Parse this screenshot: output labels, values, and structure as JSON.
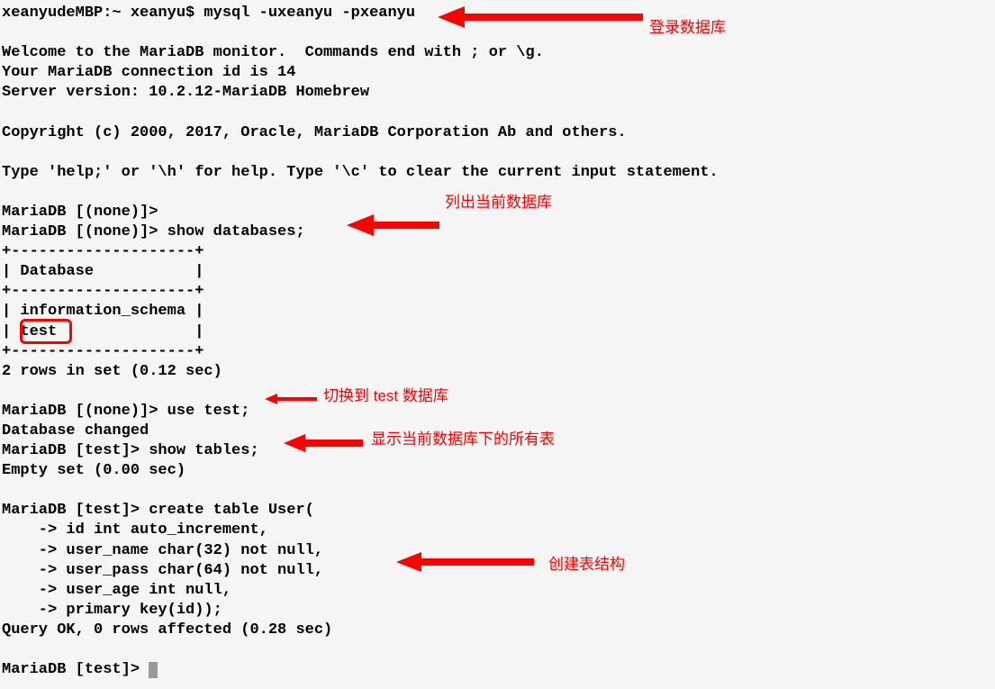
{
  "term": {
    "l0": "xeanyudeMBP:~ xeanyu$ mysql -uxeanyu -pxeanyu",
    "blank": "",
    "l1": "Welcome to the MariaDB monitor.  Commands end with ; or \\g.",
    "l2": "Your MariaDB connection id is 14",
    "l3": "Server version: 10.2.12-MariaDB Homebrew",
    "l4": "Copyright (c) 2000, 2017, Oracle, MariaDB Corporation Ab and others.",
    "l5": "Type 'help;' or '\\h' for help. Type '\\c' to clear the current input statement.",
    "l6": "MariaDB [(none)]>",
    "l7": "MariaDB [(none)]> show databases;",
    "l8": "+--------------------+",
    "l9": "| Database           |",
    "l10": "+--------------------+",
    "l11": "| information_schema |",
    "l12": "| test               |",
    "l13": "+--------------------+",
    "l14": "2 rows in set (0.12 sec)",
    "l15": "MariaDB [(none)]> use test;",
    "l16": "Database changed",
    "l17": "MariaDB [test]> show tables;",
    "l18": "Empty set (0.00 sec)",
    "l19": "MariaDB [test]> create table User(",
    "l20": "    -> id int auto_increment,",
    "l21": "    -> user_name char(32) not null,",
    "l22": "    -> user_pass char(64) not null,",
    "l23": "    -> user_age int null,",
    "l24": "    -> primary key(id));",
    "l25": "Query OK, 0 rows affected (0.28 sec)",
    "l26": "MariaDB [test]> "
  },
  "anno": {
    "a1": "登录数据库",
    "a2": "列出当前数据库",
    "a3": "切换到 test 数据库",
    "a4": "显示当前数据库下的所有表",
    "a5": "创建表结构"
  }
}
